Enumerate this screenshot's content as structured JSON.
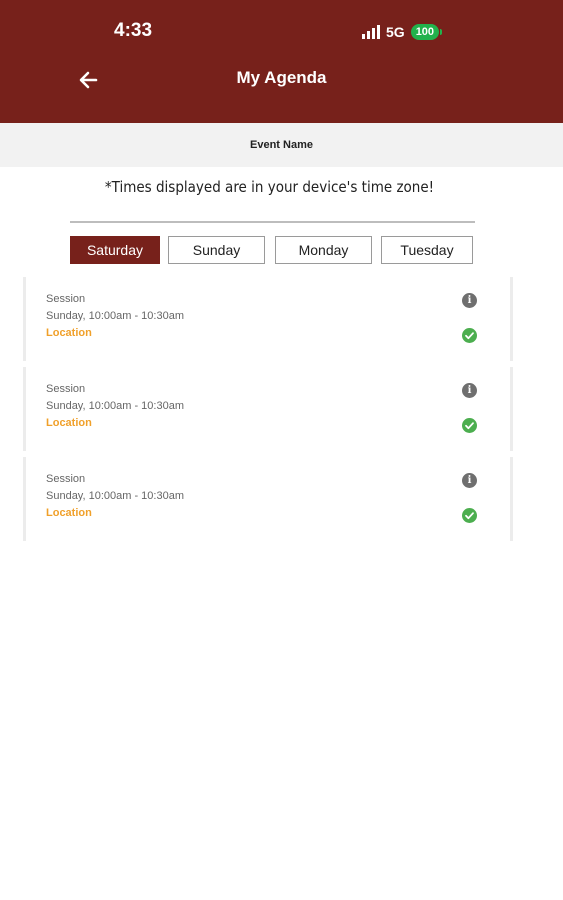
{
  "status_bar": {
    "time": "4:33",
    "network": "5G",
    "battery": "100"
  },
  "header": {
    "title": "My Agenda"
  },
  "event_name": "Event Name",
  "timezone_note": "*Times displayed are in your device's time zone!",
  "tabs": [
    {
      "label": "Saturday",
      "active": true
    },
    {
      "label": "Sunday",
      "active": false
    },
    {
      "label": "Monday",
      "active": false
    },
    {
      "label": "Tuesday",
      "active": false
    }
  ],
  "sessions": [
    {
      "type": "Session",
      "time": "Sunday, 10:00am - 10:30am",
      "location": "Location",
      "added": true
    },
    {
      "type": "Session",
      "time": "Sunday, 10:00am - 10:30am",
      "location": "Location",
      "added": true
    },
    {
      "type": "Session",
      "time": "Sunday, 10:00am - 10:30am",
      "location": "Location",
      "added": true
    }
  ],
  "colors": {
    "header": "#77211b",
    "location": "#f0a02a",
    "check": "#4cae4f",
    "battery": "#22b24c"
  }
}
